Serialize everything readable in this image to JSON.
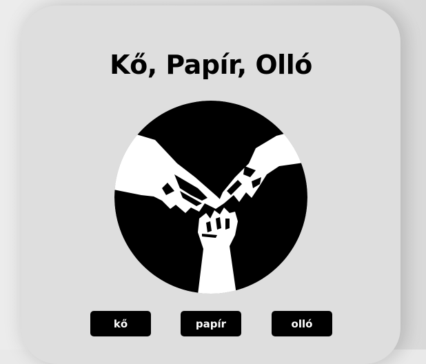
{
  "game": {
    "title": "Kő, Papír, Olló",
    "emblem_icon": "rock-paper-scissors-hands-icon",
    "choices": [
      {
        "label": "kő",
        "icon": "rock"
      },
      {
        "label": "papír",
        "icon": "paper"
      },
      {
        "label": "olló",
        "icon": "scissors"
      }
    ]
  },
  "colors": {
    "card_background": "#dedede",
    "button_background": "#000000",
    "button_text": "#ffffff",
    "title_text": "#000000"
  }
}
